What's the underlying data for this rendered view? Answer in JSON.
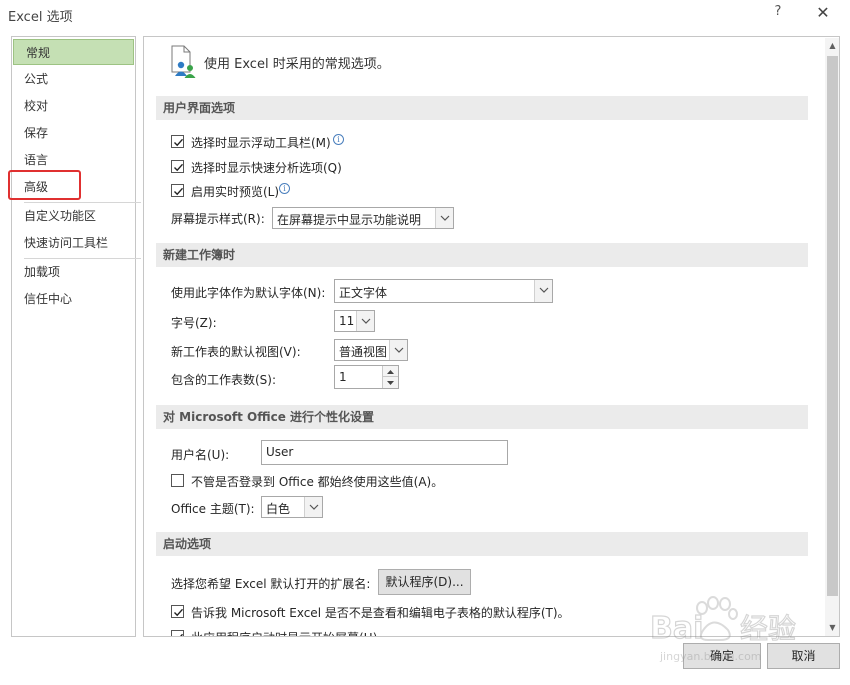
{
  "window": {
    "title": "Excel 选项",
    "help": "?",
    "close": "✕"
  },
  "sidebar": {
    "items": [
      {
        "label": "常规"
      },
      {
        "label": "公式"
      },
      {
        "label": "校对"
      },
      {
        "label": "保存"
      },
      {
        "label": "语言"
      },
      {
        "label": "高级"
      },
      {
        "label": "自定义功能区"
      },
      {
        "label": "快速访问工具栏"
      },
      {
        "label": "加载项"
      },
      {
        "label": "信任中心"
      }
    ],
    "active_index": 0,
    "highlight_color": "#e03030",
    "active_color": "#c5e0b4"
  },
  "content": {
    "intro": "使用 Excel 时采用的常规选项。",
    "ui_section": {
      "title": "用户界面选项",
      "mini_toolbar": {
        "label": "选择时显示浮动工具栏(M)",
        "checked": true
      },
      "quick_analysis": {
        "label": "选择时显示快速分析选项(Q)",
        "checked": true
      },
      "live_preview": {
        "label": "启用实时预览(L)",
        "checked": true
      },
      "screentip_label": "屏幕提示样式(R):",
      "screentip_value": "在屏幕提示中显示功能说明"
    },
    "workbook_section": {
      "title": "新建工作簿时",
      "font_label": "使用此字体作为默认字体(N):",
      "font_value": "正文字体",
      "size_label": "字号(Z):",
      "size_value": "11",
      "view_label": "新工作表的默认视图(V):",
      "view_value": "普通视图",
      "sheets_label": "包含的工作表数(S):",
      "sheets_value": "1"
    },
    "personalize_section": {
      "title": "对 Microsoft Office 进行个性化设置",
      "username_label": "用户名(U):",
      "username_value": "User",
      "always_use": {
        "label": "不管是否登录到 Office 都始终使用这些值(A)。",
        "checked": false
      },
      "theme_label": "Office 主题(T):",
      "theme_value": "白色"
    },
    "startup_section": {
      "title": "启动选项",
      "ext_label": "选择您希望 Excel 默认打开的扩展名:",
      "default_programs_button": "默认程序(D)...",
      "tell_me": {
        "label": "告诉我 Microsoft Excel 是否不是查看和编辑电子表格的默认程序(T)。",
        "checked": true
      },
      "show_start_screen": {
        "label": "此应用程序启动时显示开始屏幕(H)",
        "checked": true
      }
    }
  },
  "footer": {
    "ok": "确定",
    "cancel": "取消"
  },
  "watermark": {
    "text": "Bai 经验",
    "sub": "jingyan.baidu.com"
  }
}
